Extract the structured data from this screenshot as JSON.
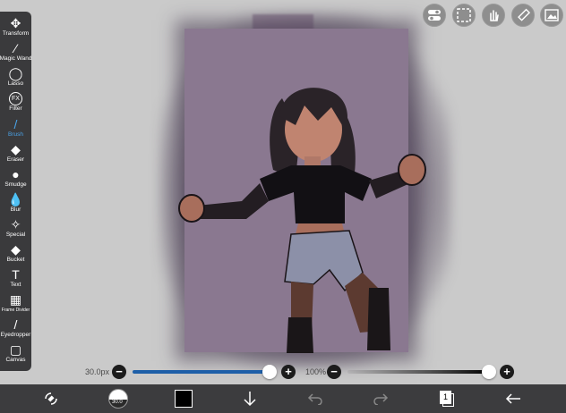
{
  "toolbar": {
    "items": [
      {
        "label": "Transform",
        "icon": "transform-icon",
        "glyph": "✥"
      },
      {
        "label": "Magic Wand",
        "icon": "magic-wand-icon",
        "glyph": "⁄"
      },
      {
        "label": "Lasso",
        "icon": "lasso-icon",
        "glyph": "◯"
      },
      {
        "label": "Filter",
        "icon": "fx-icon",
        "glyph": "FX"
      },
      {
        "label": "Brush",
        "icon": "brush-icon",
        "glyph": "/"
      },
      {
        "label": "Eraser",
        "icon": "eraser-icon",
        "glyph": "◆"
      },
      {
        "label": "Smudge",
        "icon": "smudge-icon",
        "glyph": "●"
      },
      {
        "label": "Blur",
        "icon": "blur-drop-icon",
        "glyph": "💧"
      },
      {
        "label": "Special",
        "icon": "special-wand-icon",
        "glyph": "✧"
      },
      {
        "label": "Bucket",
        "icon": "bucket-icon",
        "glyph": "◆"
      },
      {
        "label": "Text",
        "icon": "text-icon",
        "glyph": "T"
      },
      {
        "label": "Frame Divider",
        "icon": "frame-divider-icon",
        "glyph": "▦"
      },
      {
        "label": "Eyedropper",
        "icon": "eyedropper-icon",
        "glyph": "/"
      },
      {
        "label": "Canvas",
        "icon": "canvas-icon",
        "glyph": "▢"
      }
    ],
    "active": "Brush"
  },
  "brush_size": {
    "label": "30.0px",
    "value": 1.0
  },
  "opacity": {
    "label": "100%",
    "value": 1.0
  },
  "brush_preview_label": "30.0",
  "current_color": "#000000",
  "layers_count": "1",
  "colors": {
    "accent": "#4aa3e8",
    "toolbar": "#3a3a3c",
    "slider_fill": "#1e5fa8"
  }
}
